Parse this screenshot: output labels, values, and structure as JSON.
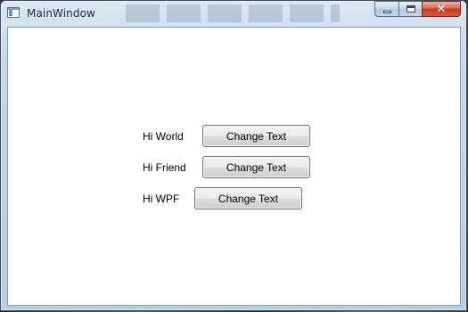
{
  "window": {
    "title": "MainWindow",
    "close_glyph": "✕"
  },
  "rows": [
    {
      "label": "Hi World",
      "button": "Change Text"
    },
    {
      "label": "Hi Friend",
      "button": "Change Text"
    },
    {
      "label": "Hi WPF",
      "button": "Change Text"
    }
  ]
}
